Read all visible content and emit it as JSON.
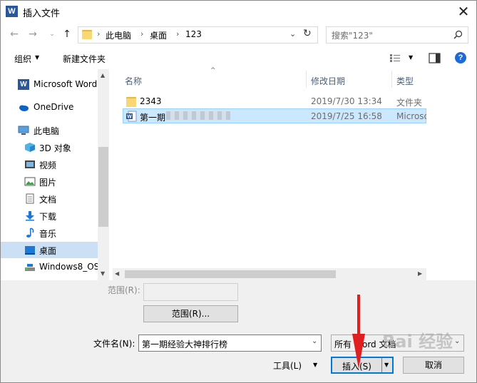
{
  "window": {
    "title": "插入文件",
    "app_icon": "word-icon"
  },
  "nav": {
    "breadcrumbs": [
      "此电脑",
      "桌面",
      "123"
    ],
    "search_placeholder": "搜索\"123\""
  },
  "toolbar": {
    "organize": "组织",
    "new_folder": "新建文件夹"
  },
  "sidebar": {
    "items": [
      {
        "label": "Microsoft Word",
        "icon": "word-icon"
      },
      {
        "label": "OneDrive",
        "icon": "cloud-icon"
      },
      {
        "label": "此电脑",
        "icon": "computer-icon"
      },
      {
        "label": "3D 对象",
        "icon": "cube-icon"
      },
      {
        "label": "视频",
        "icon": "video-icon"
      },
      {
        "label": "图片",
        "icon": "picture-icon"
      },
      {
        "label": "文档",
        "icon": "document-icon"
      },
      {
        "label": "下载",
        "icon": "download-icon"
      },
      {
        "label": "音乐",
        "icon": "music-icon"
      },
      {
        "label": "桌面",
        "icon": "desktop-icon",
        "selected": true
      },
      {
        "label": "Windows8_OS",
        "icon": "drive-icon"
      }
    ]
  },
  "file_list": {
    "columns": [
      "名称",
      "修改日期",
      "类型"
    ],
    "rows": [
      {
        "name": "2343",
        "date": "2019/7/30 13:34",
        "type": "文件夹",
        "icon": "folder-icon"
      },
      {
        "name": "第一期",
        "date": "2019/7/25 16:58",
        "type": "Microsoft",
        "icon": "word-doc-icon",
        "selected": true
      }
    ]
  },
  "bottom": {
    "range_label": "范围(R):",
    "range_button": "范围(R)...",
    "filename_label": "文件名(N):",
    "filename_value": "第一期经验大神排行榜",
    "filetype_value": "所有 Word 文档",
    "tools": "工具(L)",
    "insert": "插入(S)",
    "cancel": "取消"
  },
  "watermark": "Bai 经验",
  "colors": {
    "selection": "#cce8ff",
    "nav_selection": "#cce0f5",
    "accent": "#0078d7",
    "annotation": "#e02020"
  }
}
